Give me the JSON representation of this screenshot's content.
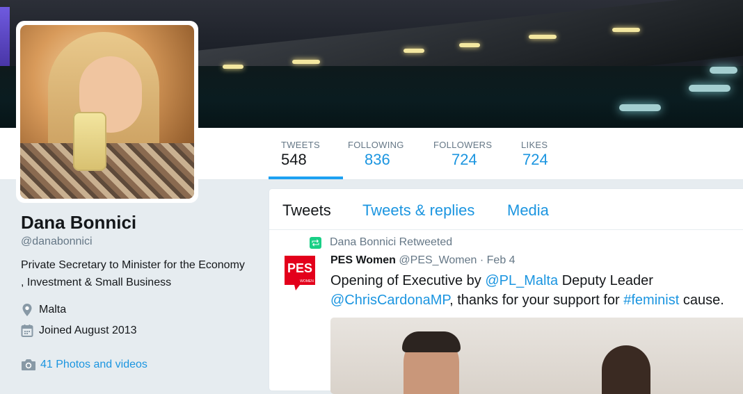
{
  "profile": {
    "name": "Dana Bonnici",
    "handle": "@danabonnici",
    "bio": "Private Secretary to Minister for the Economy , Investment & Small Business",
    "location": "Malta",
    "joined": "Joined August 2013",
    "photos_link": "41 Photos and videos"
  },
  "stats": [
    {
      "label": "TWEETS",
      "value": "548",
      "active": true
    },
    {
      "label": "FOLLOWING",
      "value": "836",
      "active": false
    },
    {
      "label": "FOLLOWERS",
      "value": "724",
      "active": false
    },
    {
      "label": "LIKES",
      "value": "724",
      "active": false
    }
  ],
  "tabs": [
    {
      "label": "Tweets"
    },
    {
      "label": "Tweets & replies"
    },
    {
      "label": "Media"
    }
  ],
  "tweet": {
    "retweet_label": "Dana Bonnici Retweeted",
    "author": "PES Women",
    "author_handle": "@PES_Women",
    "dot": "·",
    "date": "Feb 4",
    "avatar_text": "PES",
    "avatar_subtext": "WOMEN",
    "text_1": "Opening of Executive by ",
    "link_1": "@PL_Malta",
    "text_2": " Deputy Leader ",
    "link_2": "@ChrisCardonaMP",
    "text_3": ", thanks for your support for ",
    "link_3": "#feminist",
    "text_4": " cause."
  },
  "colors": {
    "accent": "#1da1f2",
    "link": "#1b95e0",
    "retweet_green": "#19cf86",
    "pes_red": "#e3001b"
  }
}
